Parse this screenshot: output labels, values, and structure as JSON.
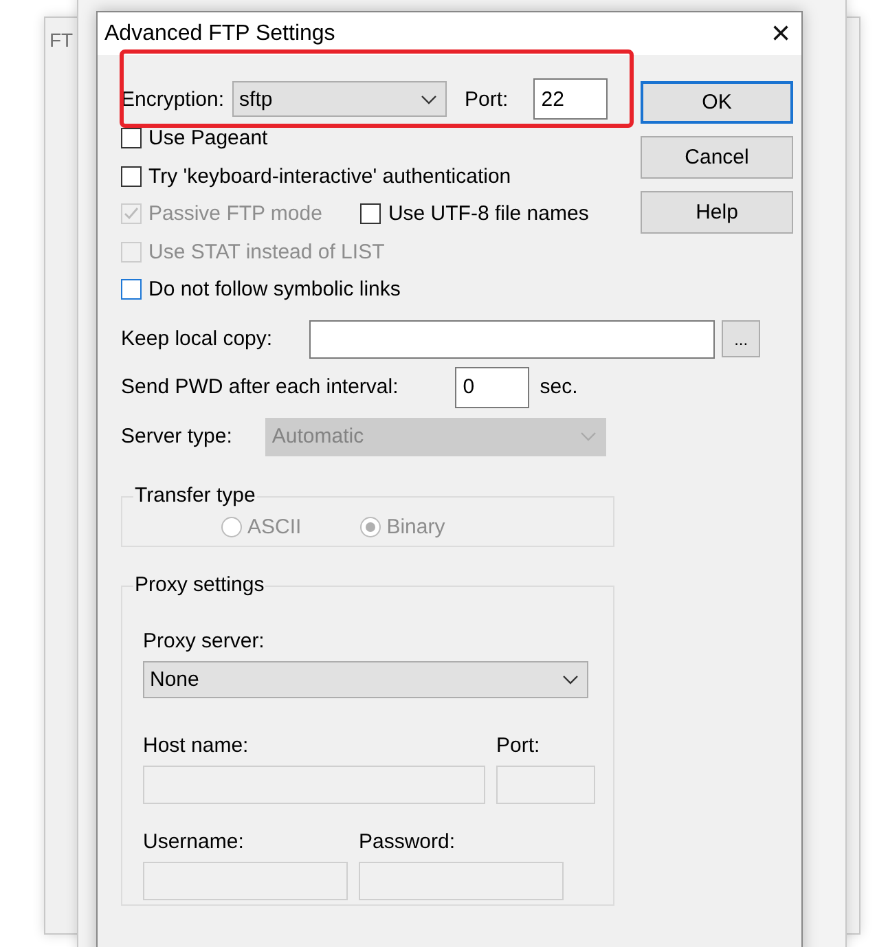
{
  "background_windows": [
    {
      "title": "FT"
    },
    {
      "kind": "window"
    }
  ],
  "dialog": {
    "title": "Advanced FTP Settings",
    "close": "×"
  },
  "encryption": {
    "label": "Encryption:",
    "value": "sftp"
  },
  "port": {
    "label": "Port:",
    "value": "22"
  },
  "buttons": [
    {
      "label": "OK",
      "default": true
    },
    {
      "label": "Cancel",
      "default": false
    },
    {
      "label": "Help",
      "default": false
    }
  ],
  "option_rows": [
    {
      "items": [
        {
          "label": "Use Pageant",
          "checked": false,
          "disabled": false,
          "focused": false
        }
      ]
    },
    {
      "items": [
        {
          "label": "Try 'keyboard-interactive' authentication",
          "checked": false,
          "disabled": false,
          "focused": false
        }
      ]
    },
    {
      "items": [
        {
          "label": "Passive FTP mode",
          "checked": true,
          "disabled": true,
          "focused": false
        },
        {
          "label": "Use UTF-8 file names",
          "checked": false,
          "disabled": false,
          "focused": false
        }
      ]
    },
    {
      "items": [
        {
          "label": "Use STAT instead of LIST",
          "checked": false,
          "disabled": true,
          "focused": false
        }
      ]
    },
    {
      "items": [
        {
          "label": "Do not follow symbolic links",
          "checked": false,
          "disabled": false,
          "focused": true
        }
      ]
    }
  ],
  "keep_local_copy": {
    "label": "Keep local copy:",
    "browse": "..."
  },
  "send_pwd": {
    "label": "Send PWD after each interval:",
    "value": "0",
    "unit": "sec."
  },
  "server_type": {
    "label": "Server type:",
    "value": "Automatic",
    "disabled": true
  },
  "transfer_type": {
    "title": "Transfer type",
    "disabled": true,
    "options": [
      {
        "label": "ASCII",
        "selected": false
      },
      {
        "label": "Binary",
        "selected": true
      }
    ]
  },
  "proxy": {
    "title": "Proxy settings",
    "server_label": "Proxy server:",
    "server": "None",
    "fields": [
      {
        "label": "Host name:",
        "disabled": true
      },
      {
        "label": "Port:",
        "disabled": true
      },
      {
        "label": "Username:",
        "disabled": true
      },
      {
        "label": "Password:",
        "disabled": true
      }
    ]
  }
}
